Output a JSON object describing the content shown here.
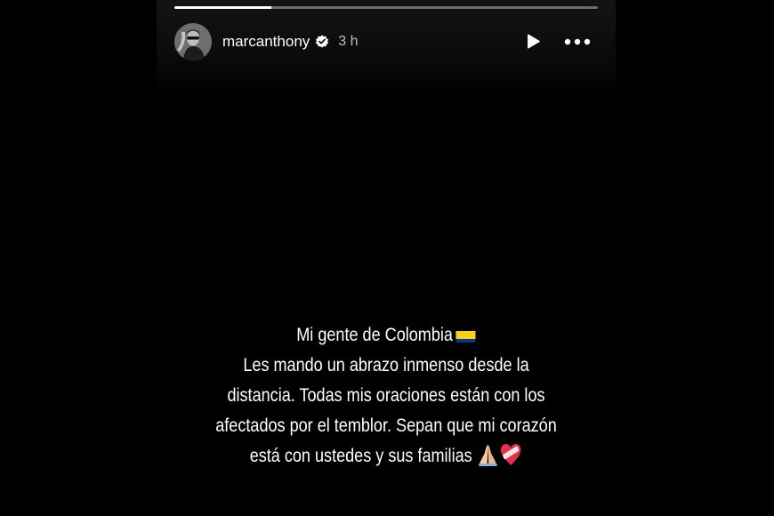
{
  "story": {
    "progress": 0.23,
    "user": {
      "username": "marcanthony",
      "verified": true,
      "time": "3 h",
      "avatar_icon": "profile-photo"
    },
    "controls": {
      "play_icon": "play-icon",
      "more_icon": "more-options-icon"
    },
    "caption": {
      "line1": "Mi gente de Colombia",
      "line2": "Les mando un abrazo inmenso desde la",
      "line3": "distancia. Todas mis oraciones están con los",
      "line4": "afectados por el temblor. Sepan que mi corazón",
      "line5": "está con ustedes y sus familias"
    },
    "emojis": [
      "colombia-flag",
      "praying-hands",
      "heart-with-bandage"
    ]
  },
  "colors": {
    "background": "#000000",
    "text": "#ffffff",
    "flag_yellow": "#FCD116",
    "flag_blue": "#003893",
    "flag_red": "#CE1126",
    "heart": "#e8304a"
  }
}
